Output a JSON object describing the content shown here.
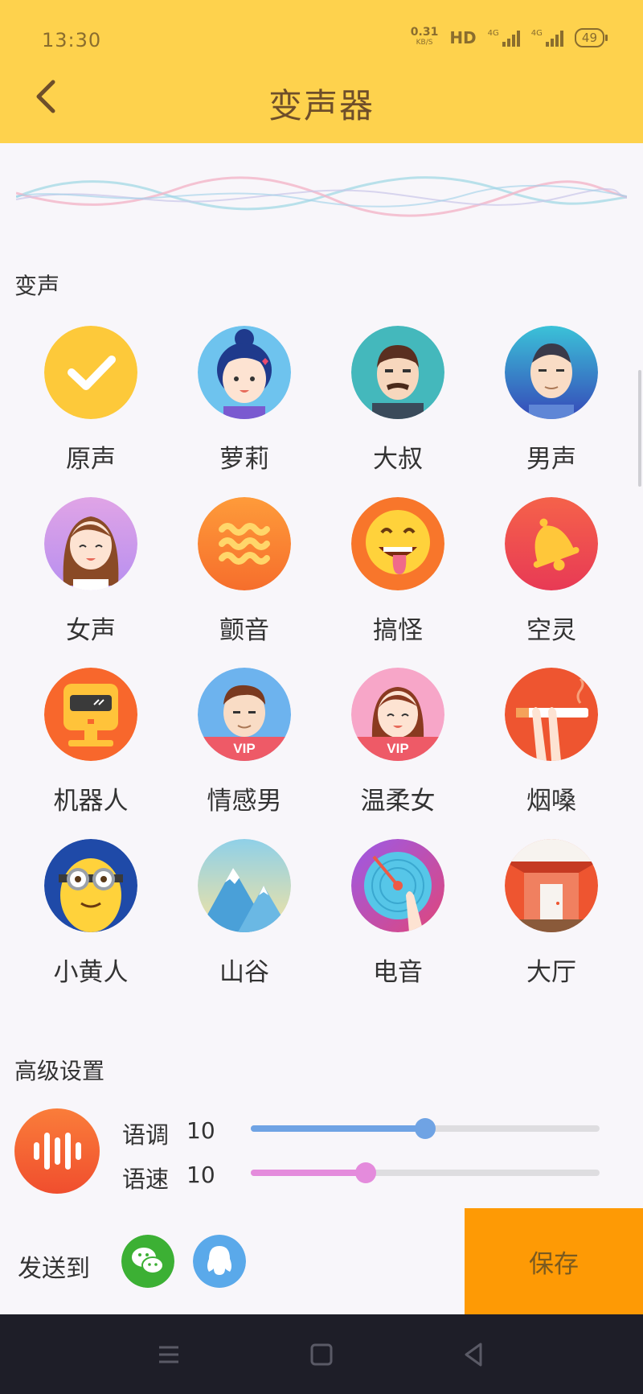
{
  "status_bar": {
    "time": "13:30",
    "net_speed": "0.31",
    "net_unit": "KB/S",
    "hd": "HD",
    "network_1": "4G",
    "network_2": "4G",
    "battery": "49"
  },
  "header": {
    "title": "变声器",
    "color": "#fed24d"
  },
  "voice_section": {
    "title": "变声",
    "items": [
      {
        "label": "原声",
        "icon": "check-icon",
        "selected": true
      },
      {
        "label": "萝莉",
        "icon": "loli-avatar-icon"
      },
      {
        "label": "大叔",
        "icon": "uncle-avatar-icon"
      },
      {
        "label": "男声",
        "icon": "male-avatar-icon"
      },
      {
        "label": "女声",
        "icon": "female-avatar-icon"
      },
      {
        "label": "颤音",
        "icon": "tremolo-waves-icon"
      },
      {
        "label": "搞怪",
        "icon": "tongue-emoji-icon"
      },
      {
        "label": "空灵",
        "icon": "bell-icon"
      },
      {
        "label": "机器人",
        "icon": "robot-icon"
      },
      {
        "label": "情感男",
        "icon": "emotional-male-avatar-icon",
        "badge": "VIP"
      },
      {
        "label": "温柔女",
        "icon": "gentle-female-avatar-icon",
        "badge": "VIP"
      },
      {
        "label": "烟嗓",
        "icon": "cigarette-icon"
      },
      {
        "label": "小黄人",
        "icon": "minion-icon"
      },
      {
        "label": "山谷",
        "icon": "mountain-icon"
      },
      {
        "label": "电音",
        "icon": "vinyl-record-icon"
      },
      {
        "label": "大厅",
        "icon": "hall-door-icon"
      }
    ]
  },
  "advanced": {
    "title": "高级设置",
    "pitch": {
      "label": "语调",
      "value": "10",
      "level": 0.5,
      "color": "#6fa3e4"
    },
    "speed": {
      "label": "语速",
      "value": "10",
      "level": 0.33,
      "color": "#e48bdc"
    }
  },
  "send": {
    "label": "发送到",
    "targets": [
      "wechat-icon",
      "qq-icon"
    ]
  },
  "save_button": "保存"
}
